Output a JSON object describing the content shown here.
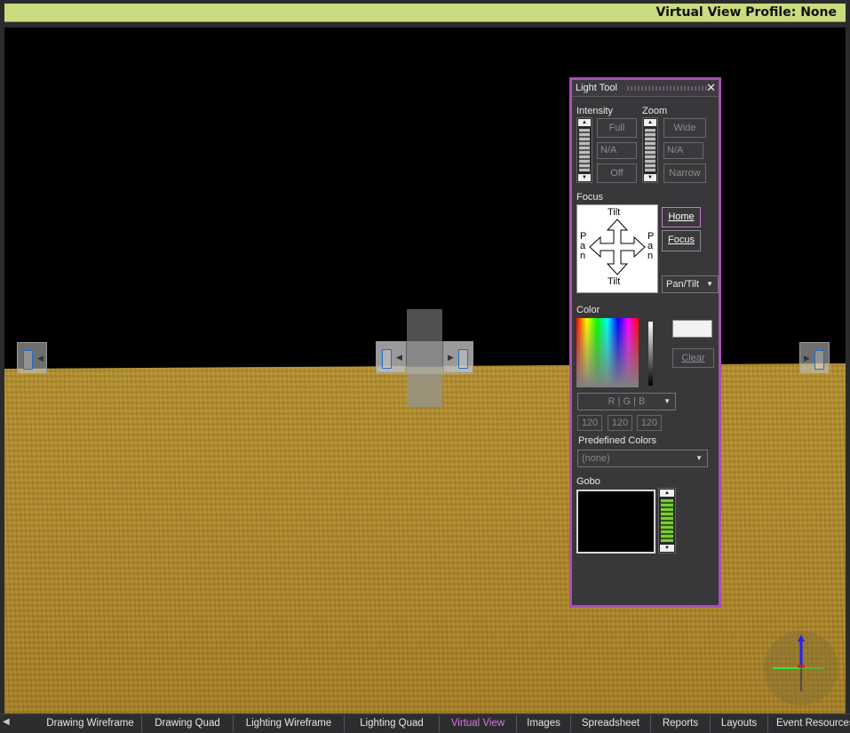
{
  "profile_bar": {
    "label": "Virtual View Profile: None",
    "color": "#c9dc7e"
  },
  "light_tool": {
    "title": "Light Tool",
    "intensity": {
      "label": "Intensity",
      "full": "Full",
      "value_placeholder": "N/A",
      "off": "Off"
    },
    "zoom": {
      "label": "Zoom",
      "wide": "Wide",
      "value_placeholder": "N/A",
      "narrow": "Narrow"
    },
    "focus": {
      "label": "Focus",
      "tilt_top": "Tilt",
      "tilt_bottom": "Tilt",
      "pan_left": [
        "P",
        "a",
        "n"
      ],
      "pan_right": [
        "P",
        "a",
        "n"
      ],
      "home": "Home",
      "focus_btn": "Focus",
      "mode": "Pan/Tilt"
    },
    "color": {
      "label": "Color",
      "clear": "Clear",
      "mode": "R | G | B",
      "r": "120",
      "g": "120",
      "b": "120",
      "predefined_label": "Predefined Colors",
      "predefined_value": "(none)"
    },
    "gobo": {
      "label": "Gobo"
    },
    "accent": "#b04db8"
  },
  "tabs": [
    {
      "label": "Drawing Wireframe",
      "active": false
    },
    {
      "label": "Drawing Quad",
      "active": false
    },
    {
      "label": "Lighting Wireframe",
      "active": false
    },
    {
      "label": "Lighting Quad",
      "active": false
    },
    {
      "label": "Virtual View",
      "active": true
    },
    {
      "label": "Images",
      "active": false
    },
    {
      "label": "Spreadsheet",
      "active": false
    },
    {
      "label": "Reports",
      "active": false
    },
    {
      "label": "Layouts",
      "active": false
    },
    {
      "label": "Event Resources",
      "active": false
    }
  ]
}
